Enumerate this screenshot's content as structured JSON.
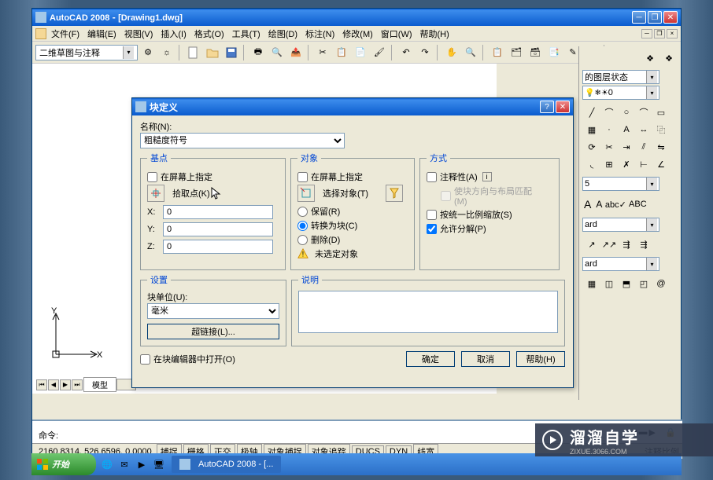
{
  "titlebar": {
    "app": "AutoCAD 2008",
    "doc": "[Drawing1.dwg]"
  },
  "menus": [
    "文件(F)",
    "编辑(E)",
    "视图(V)",
    "插入(I)",
    "格式(O)",
    "工具(T)",
    "绘图(D)",
    "标注(N)",
    "修改(M)",
    "窗口(W)",
    "帮助(H)"
  ],
  "workspace_combo": "二维草图与注释",
  "layer_dropdown": "0",
  "layer_state_dropdown": "的图层状态",
  "right_combos": [
    "ard",
    "5",
    "ard",
    "ard"
  ],
  "right_text": [
    "A",
    "A",
    "A"
  ],
  "model_tabs": {
    "active": "模型"
  },
  "ucs": {
    "y": "Y",
    "x": "X"
  },
  "cmd": {
    "prompt": "命令:"
  },
  "status": {
    "coords": "2160.8314, 526.6596, 0.0000",
    "buttons": [
      "捕捉",
      "栅格",
      "正交",
      "极轴",
      "对象捕捉",
      "对象追踪",
      "DUCS",
      "DYN",
      "线宽"
    ],
    "annot": "注释比例"
  },
  "dialog": {
    "title": "块定义",
    "name_label": "名称(N):",
    "name_value": "粗糙度符号",
    "base": {
      "legend": "基点",
      "onscreen": "在屏幕上指定",
      "pick": "拾取点(K)",
      "x_lbl": "X:",
      "x_val": "0",
      "y_lbl": "Y:",
      "y_val": "0",
      "z_lbl": "Z:",
      "z_val": "0"
    },
    "objects": {
      "legend": "对象",
      "onscreen": "在屏幕上指定",
      "select": "选择对象(T)",
      "retain": "保留(R)",
      "convert": "转换为块(C)",
      "delete": "删除(D)",
      "none": "未选定对象"
    },
    "behavior": {
      "legend": "方式",
      "annotative": "注释性(A)",
      "match": "使块方向与布局匹配(M)",
      "scale": "按统一比例缩放(S)",
      "explode": "允许分解(P)"
    },
    "settings": {
      "legend": "设置",
      "unit_lbl": "块单位(U):",
      "unit_val": "毫米",
      "hyperlink": "超链接(L)..."
    },
    "desc": {
      "legend": "说明",
      "value": ""
    },
    "open_editor": "在块编辑器中打开(O)",
    "ok": "确定",
    "cancel": "取消",
    "help": "帮助(H)"
  },
  "taskbar": {
    "start": "开始",
    "task": "AutoCAD 2008 - [..."
  },
  "watermark": {
    "brand": "溜溜自学",
    "url": "ZIXUE.3066.COM"
  }
}
